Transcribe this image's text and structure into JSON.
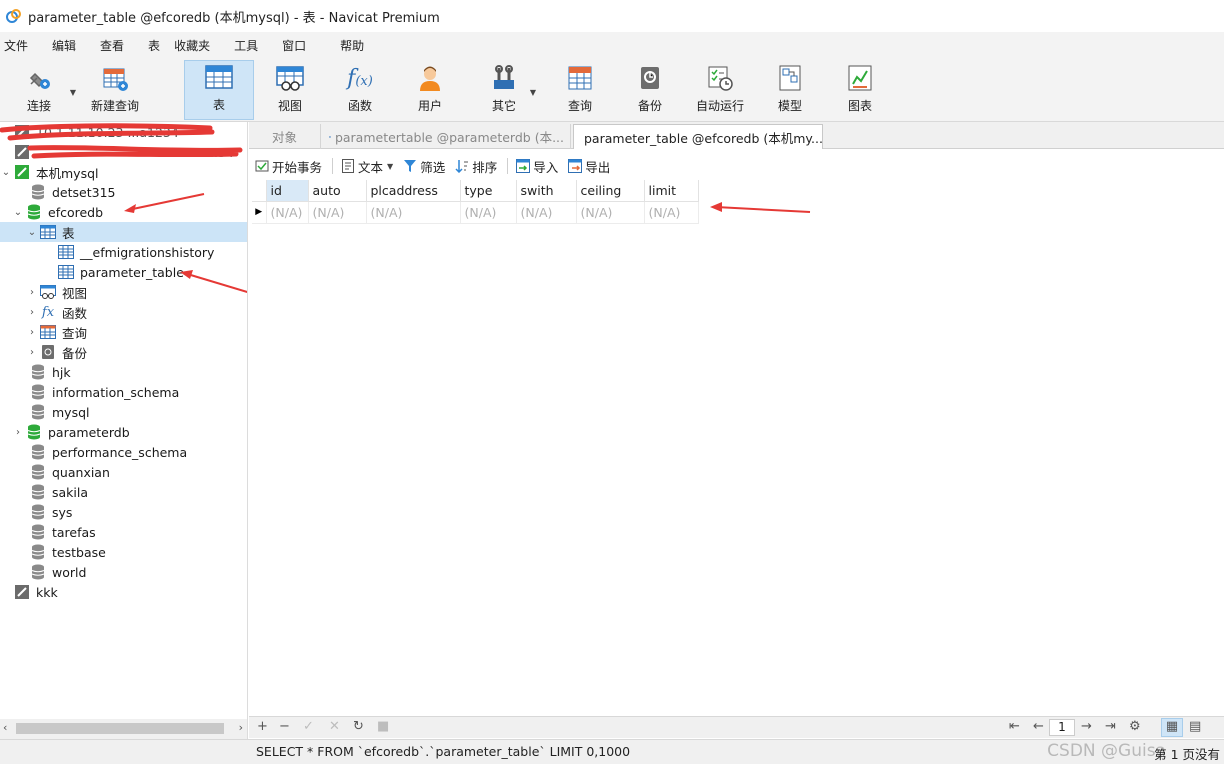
{
  "window": {
    "title": "parameter_table @efcoredb (本机mysql) - 表 - Navicat Premium"
  },
  "menu": [
    "文件",
    "编辑",
    "查看",
    "表",
    "收藏夹",
    "工具",
    "窗口",
    "帮助"
  ],
  "toolbar": {
    "items": [
      {
        "label": "连接",
        "icon": "plug-icon"
      },
      {
        "label": "新建查询",
        "icon": "new-query-icon"
      },
      {
        "label": "表",
        "icon": "table-icon",
        "active": true
      },
      {
        "label": "视图",
        "icon": "view-icon"
      },
      {
        "label": "函数",
        "icon": "function-icon"
      },
      {
        "label": "用户",
        "icon": "user-icon"
      },
      {
        "label": "其它",
        "icon": "tools-icon"
      },
      {
        "label": "查询",
        "icon": "query-icon"
      },
      {
        "label": "备份",
        "icon": "backup-icon"
      },
      {
        "label": "自动运行",
        "icon": "autorun-icon"
      },
      {
        "label": "模型",
        "icon": "model-icon"
      },
      {
        "label": "图表",
        "icon": "chart-icon"
      }
    ]
  },
  "sidebar": {
    "redacted_connections": [
      "10.1.11.10.23 ...a1234",
      "...34"
    ],
    "local_connection": "本机mysql",
    "databases": {
      "detset315": "detset315",
      "efcoredb": "efcoredb",
      "tables_node": "表",
      "tables": [
        "__efmigrationshistory",
        "parameter_table"
      ],
      "view_node": "视图",
      "function_node": "函数",
      "query_node": "查询",
      "backup_node": "备份",
      "others": [
        "hjk",
        "information_schema",
        "mysql",
        "parameterdb",
        "performance_schema",
        "quanxian",
        "sakila",
        "sys",
        "tarefas",
        "testbase",
        "world"
      ]
    },
    "other_connection": "kkk"
  },
  "tabs": {
    "objects": "对象",
    "tab1": "parametertable @parameterdb (本...",
    "tab2": "parameter_table @efcoredb (本机my..."
  },
  "subtoolbar": {
    "begin_transaction": "开始事务",
    "text": "文本",
    "filter": "筛选",
    "sort": "排序",
    "import": "导入",
    "export": "导出"
  },
  "grid": {
    "columns": [
      "id",
      "auto",
      "plcaddress",
      "type",
      "swith",
      "ceiling",
      "limit"
    ],
    "rows": [
      [
        "(N/A)",
        "(N/A)",
        "(N/A)",
        "(N/A)",
        "(N/A)",
        "(N/A)",
        "(N/A)"
      ]
    ]
  },
  "pager": {
    "page": "1"
  },
  "status": {
    "sql": "SELECT * FROM `efcoredb`.`parameter_table` LIMIT 0,1000",
    "page_info": "第 1 页没有",
    "watermark": "CSDN @Guisa"
  },
  "colors": {
    "annotation_red": "#e53935",
    "db_green": "#2eaa3a",
    "selected_blue": "#cce4f7"
  }
}
